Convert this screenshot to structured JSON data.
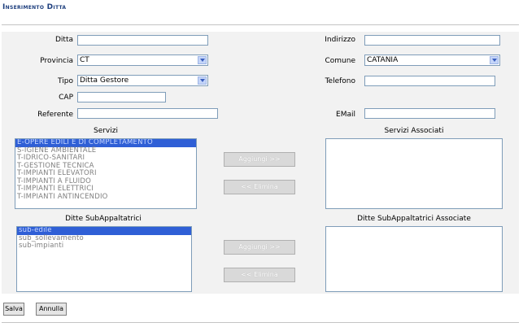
{
  "page": {
    "title": "Inserimento Ditta"
  },
  "fields": {
    "ditta": {
      "label": "Ditta",
      "value": ""
    },
    "indirizzo": {
      "label": "Indirizzo",
      "value": ""
    },
    "provincia": {
      "label": "Provincia",
      "value": "CT"
    },
    "comune": {
      "label": "Comune",
      "value": "CATANIA"
    },
    "tipo": {
      "label": "Tipo",
      "value": "Ditta Gestore"
    },
    "telefono": {
      "label": "Telefono",
      "value": ""
    },
    "cap": {
      "label": "CAP",
      "value": ""
    },
    "referente": {
      "label": "Referente",
      "value": ""
    },
    "email": {
      "label": "EMail",
      "value": ""
    }
  },
  "servizi": {
    "label": "Servizi",
    "items": [
      "E-OPERE EDILI E DI COMPLETAMENTO",
      "S-IGIENE AMBIENTALE",
      "T-IDRICO-SANITARI",
      "T-GESTIONE TECNICA",
      "T-IMPIANTI ELEVATORI",
      "T-IMPIANTI A FLUIDO",
      "T-IMPIANTI ELETTRICI",
      "T-IMPIANTI ANTINCENDIO"
    ],
    "selected_index": 0
  },
  "servizi_associati": {
    "label": "Servizi Associati"
  },
  "ditte_sub": {
    "label": "Ditte SubAppaltatrici",
    "items": [
      "sub-edile",
      "sub_sollevamento",
      "sub-impianti"
    ],
    "selected_index": 0
  },
  "ditte_sub_associate": {
    "label": "Ditte SubAppaltatrici Associate"
  },
  "buttons": {
    "aggiungi": "Aggiungi >>",
    "elimina": "<< Elimina",
    "salva": "Salva",
    "annulla": "Annulla"
  },
  "colors": {
    "title": "#1e3f7e",
    "selection": "#2f5fd6",
    "panel": "#f2f2f2"
  }
}
